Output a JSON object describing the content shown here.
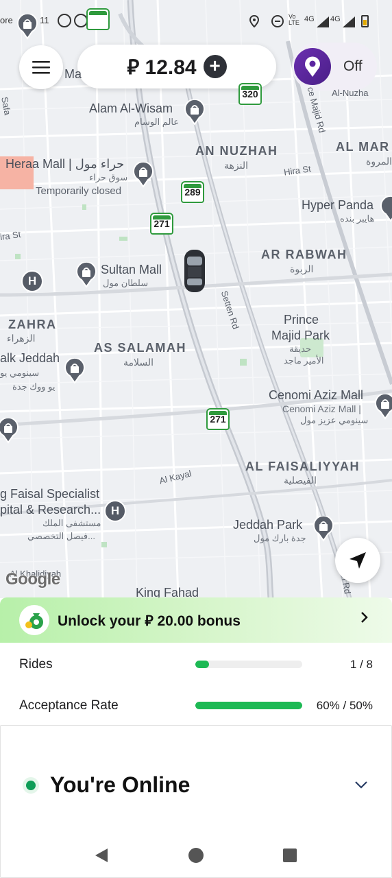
{
  "statusbar": {
    "left_text": "ore",
    "time_fragment": "11",
    "network": "4G",
    "network2": "4G",
    "volte": "Vo LTE"
  },
  "header": {
    "balance": "⃁ 12.84",
    "plus_label": "+",
    "status_toggle": "Off"
  },
  "map": {
    "areas": [
      {
        "en": "AN NUZHAH",
        "ar": "النزهة"
      },
      {
        "en": "AL MAR",
        "ar": "المروة"
      },
      {
        "en": "AR RABWAH",
        "ar": "الربوة"
      },
      {
        "en": "ZAHRA",
        "ar": "الزهراء"
      },
      {
        "en": "AS SALAMAH",
        "ar": "السلامة"
      },
      {
        "en": "AL FAISALIYYAH",
        "ar": "الفيصلية"
      }
    ],
    "pois": {
      "alam_wisam": "Alam Al-Wisam",
      "alam_wisam_ar": "عالم الوسام",
      "heraa": "Heraa Mall | حراء مول",
      "heraa_ar": "سوق حراء",
      "heraa_status": "Temporarily closed",
      "sultan": "Sultan Mall",
      "sultan_ar": "سلطان مول",
      "hyper_panda": "Hyper Panda",
      "hyper_panda_ar": "هايبر بنده",
      "prince_majid_1": "Prince",
      "prince_majid_2": "Majid Park",
      "prince_majid_ar1": "حديقة",
      "prince_majid_ar2": "الأمير ماجد",
      "walk_jeddah": "alk Jeddah",
      "walk_jeddah_ar": "سينومي يو",
      "walk_jeddah_ar2": "يو ووك جدة",
      "cenomi_aziz": "Cenomi Aziz Mall",
      "cenomi_aziz_2": "Cenomi Aziz Mall |",
      "cenomi_aziz_ar": "سينومي عزيز مول",
      "faisal_1": "g Faisal Specialist",
      "faisal_2": "pital & Research...",
      "faisal_ar1": "مستشفى الملك",
      "faisal_ar2": "فيصل التخصصي...",
      "jeddah_park": "Jeddah Park",
      "jeddah_park_ar": "جدة بارك مول",
      "king_fahad": "King Fahad",
      "al_khalidiyah": "Al Khalidiyah",
      "ma": "Ma",
      "al_nuzha": "Al-Nuzha"
    },
    "streets": {
      "hira": "Hira St",
      "ira": "ira St",
      "setten": "Setten Rd",
      "al_kayal": "Al Kayal",
      "majid": "ce Majid Rd",
      "ren": "ren Rd",
      "safa": "Safa"
    },
    "route_shields": [
      "271",
      "289",
      "320",
      "271",
      "271"
    ],
    "google": "Google"
  },
  "bonus": {
    "text": "Unlock your ⃁ 20.00 bonus"
  },
  "progress": [
    {
      "label": "Rides",
      "value_text": "1 / 8",
      "fraction": 0.125
    },
    {
      "label": "Acceptance Rate",
      "value_text": "60% / 50%",
      "fraction": 1.0
    }
  ],
  "online": {
    "text": "You're Online"
  },
  "colors": {
    "accent_green": "#1db954",
    "online_dot": "#0f9d58",
    "toggle_purple": "#5b24a0"
  }
}
